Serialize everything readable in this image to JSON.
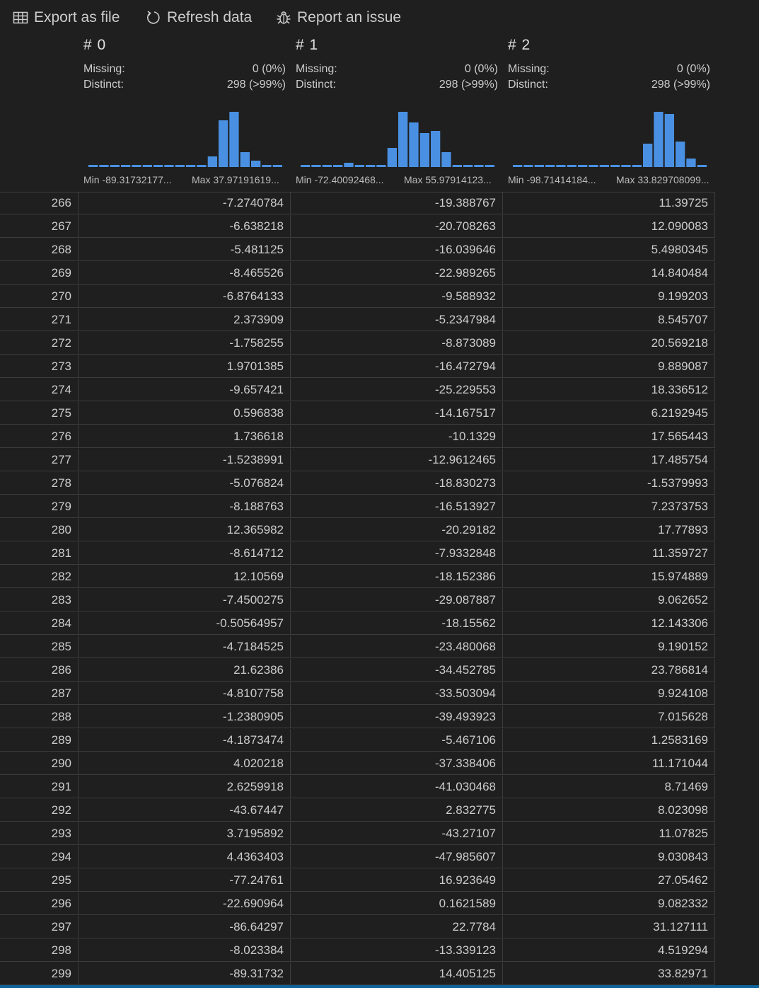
{
  "toolbar": {
    "export_label": "Export as file",
    "refresh_label": "Refresh data",
    "report_label": "Report an issue"
  },
  "columns": [
    {
      "title": "# 0",
      "missing_label": "Missing:",
      "missing_value": "0 (0%)",
      "distinct_label": "Distinct:",
      "distinct_value": "298 (>99%)",
      "min_label": "Min -89.31732177...",
      "max_label": "Max 37.97191619...",
      "histogram": [
        1,
        1,
        1,
        1,
        1,
        1,
        1,
        1,
        1,
        1,
        1,
        5,
        22,
        26,
        7,
        3,
        1,
        1
      ]
    },
    {
      "title": "# 1",
      "missing_label": "Missing:",
      "missing_value": "0 (0%)",
      "distinct_label": "Distinct:",
      "distinct_value": "298 (>99%)",
      "min_label": "Min -72.40092468...",
      "max_label": "Max 55.97914123...",
      "histogram": [
        1,
        1,
        1,
        1,
        2,
        1,
        1,
        1,
        9,
        26,
        21,
        16,
        17,
        7,
        1,
        1,
        1,
        1
      ]
    },
    {
      "title": "# 2",
      "missing_label": "Missing:",
      "missing_value": "0 (0%)",
      "distinct_label": "Distinct:",
      "distinct_value": "298 (>99%)",
      "min_label": "Min -98.71414184...",
      "max_label": "Max 33.829708099...",
      "histogram": [
        1,
        1,
        1,
        1,
        1,
        1,
        1,
        1,
        1,
        1,
        1,
        1,
        11,
        26,
        25,
        12,
        4,
        1
      ]
    }
  ],
  "rows": [
    {
      "idx": "266",
      "c0": "-7.2740784",
      "c1": "-19.388767",
      "c2": "11.39725"
    },
    {
      "idx": "267",
      "c0": "-6.638218",
      "c1": "-20.708263",
      "c2": "12.090083"
    },
    {
      "idx": "268",
      "c0": "-5.481125",
      "c1": "-16.039646",
      "c2": "5.4980345"
    },
    {
      "idx": "269",
      "c0": "-8.465526",
      "c1": "-22.989265",
      "c2": "14.840484"
    },
    {
      "idx": "270",
      "c0": "-6.8764133",
      "c1": "-9.588932",
      "c2": "9.199203"
    },
    {
      "idx": "271",
      "c0": "2.373909",
      "c1": "-5.2347984",
      "c2": "8.545707"
    },
    {
      "idx": "272",
      "c0": "-1.758255",
      "c1": "-8.873089",
      "c2": "20.569218"
    },
    {
      "idx": "273",
      "c0": "1.9701385",
      "c1": "-16.472794",
      "c2": "9.889087"
    },
    {
      "idx": "274",
      "c0": "-9.657421",
      "c1": "-25.229553",
      "c2": "18.336512"
    },
    {
      "idx": "275",
      "c0": "0.596838",
      "c1": "-14.167517",
      "c2": "6.2192945"
    },
    {
      "idx": "276",
      "c0": "1.736618",
      "c1": "-10.1329",
      "c2": "17.565443"
    },
    {
      "idx": "277",
      "c0": "-1.5238991",
      "c1": "-12.9612465",
      "c2": "17.485754"
    },
    {
      "idx": "278",
      "c0": "-5.076824",
      "c1": "-18.830273",
      "c2": "-1.5379993"
    },
    {
      "idx": "279",
      "c0": "-8.188763",
      "c1": "-16.513927",
      "c2": "7.2373753"
    },
    {
      "idx": "280",
      "c0": "12.365982",
      "c1": "-20.29182",
      "c2": "17.77893"
    },
    {
      "idx": "281",
      "c0": "-8.614712",
      "c1": "-7.9332848",
      "c2": "11.359727"
    },
    {
      "idx": "282",
      "c0": "12.10569",
      "c1": "-18.152386",
      "c2": "15.974889"
    },
    {
      "idx": "283",
      "c0": "-7.4500275",
      "c1": "-29.087887",
      "c2": "9.062652"
    },
    {
      "idx": "284",
      "c0": "-0.50564957",
      "c1": "-18.15562",
      "c2": "12.143306"
    },
    {
      "idx": "285",
      "c0": "-4.7184525",
      "c1": "-23.480068",
      "c2": "9.190152"
    },
    {
      "idx": "286",
      "c0": "21.62386",
      "c1": "-34.452785",
      "c2": "23.786814"
    },
    {
      "idx": "287",
      "c0": "-4.8107758",
      "c1": "-33.503094",
      "c2": "9.924108"
    },
    {
      "idx": "288",
      "c0": "-1.2380905",
      "c1": "-39.493923",
      "c2": "7.015628"
    },
    {
      "idx": "289",
      "c0": "-4.1873474",
      "c1": "-5.467106",
      "c2": "1.2583169"
    },
    {
      "idx": "290",
      "c0": "4.020218",
      "c1": "-37.338406",
      "c2": "11.171044"
    },
    {
      "idx": "291",
      "c0": "2.6259918",
      "c1": "-41.030468",
      "c2": "8.71469"
    },
    {
      "idx": "292",
      "c0": "-43.67447",
      "c1": "2.832775",
      "c2": "8.023098"
    },
    {
      "idx": "293",
      "c0": "3.7195892",
      "c1": "-43.27107",
      "c2": "11.07825"
    },
    {
      "idx": "294",
      "c0": "4.4363403",
      "c1": "-47.985607",
      "c2": "9.030843"
    },
    {
      "idx": "295",
      "c0": "-77.24761",
      "c1": "16.923649",
      "c2": "27.05462"
    },
    {
      "idx": "296",
      "c0": "-22.690964",
      "c1": "0.1621589",
      "c2": "9.082332"
    },
    {
      "idx": "297",
      "c0": "-86.64297",
      "c1": "22.7784",
      "c2": "31.127111"
    },
    {
      "idx": "298",
      "c0": "-8.023384",
      "c1": "-13.339123",
      "c2": "4.519294"
    },
    {
      "idx": "299",
      "c0": "-89.31732",
      "c1": "14.405125",
      "c2": "33.82971"
    }
  ],
  "colors": {
    "bar": "#4a90e2",
    "background": "#1f1f1f",
    "accent": "#0e639c"
  }
}
